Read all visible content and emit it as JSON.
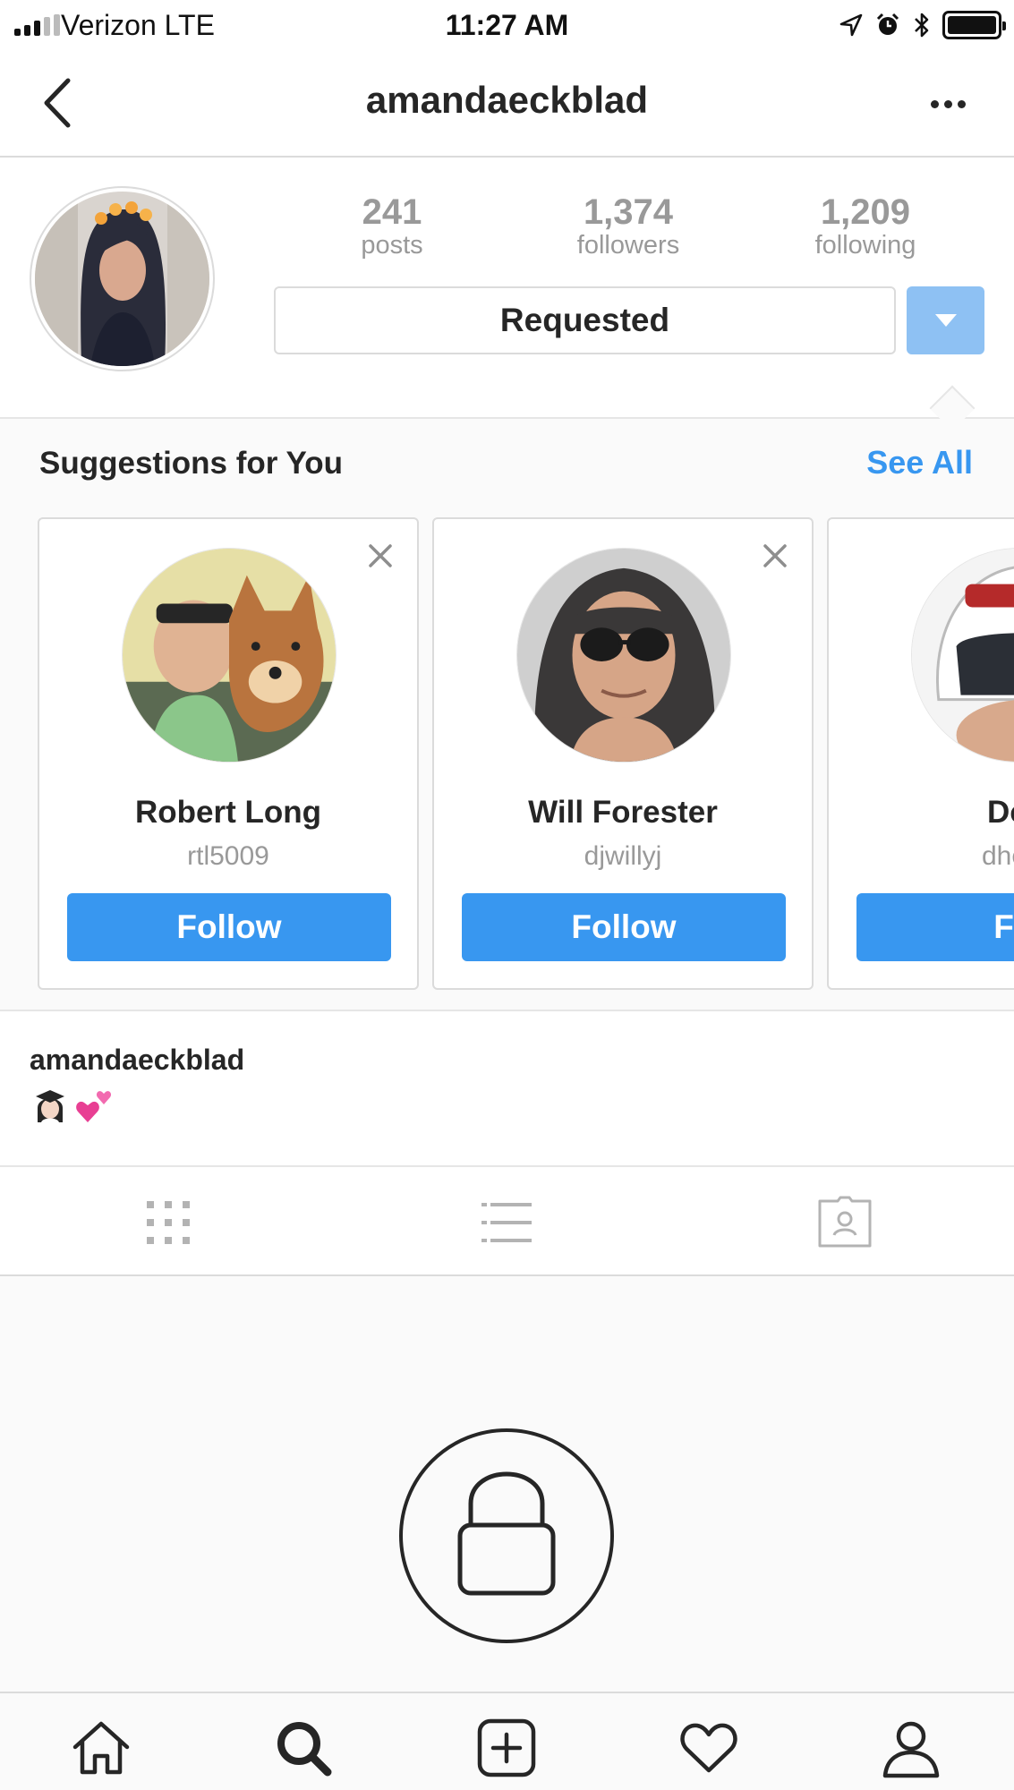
{
  "status_bar": {
    "carrier": "Verizon  LTE",
    "time": "11:27 AM",
    "battery_level": 1.0
  },
  "nav": {
    "title": "amandaeckblad",
    "back_icon": "chevron-left-icon",
    "more_icon": "ellipsis-icon"
  },
  "profile": {
    "stats": [
      {
        "value": "241",
        "label": "posts"
      },
      {
        "value": "1,374",
        "label": "followers"
      },
      {
        "value": "1,209",
        "label": "following"
      }
    ],
    "requested_label": "Requested",
    "dropdown_icon": "caret-down-icon"
  },
  "suggestions": {
    "title": "Suggestions for You",
    "see_all": "See All",
    "cards": [
      {
        "name": "Robert Long",
        "handle": "rtl5009",
        "button": "Follow"
      },
      {
        "name": "Will Forester",
        "handle": "djwillyj",
        "button": "Follow"
      },
      {
        "name": "Dou",
        "handle": "dheck",
        "button": "Fol"
      }
    ]
  },
  "bio": {
    "username": "amandaeckblad",
    "emojis": [
      "graduate-emoji",
      "two-hearts-emoji"
    ]
  },
  "view_tabs": [
    "grid-icon",
    "list-icon",
    "tagged-icon"
  ],
  "private_icon": "lock-icon",
  "tab_bar": [
    "home-icon",
    "search-icon",
    "add-post-icon",
    "heart-icon",
    "profile-icon"
  ],
  "colors": {
    "accent": "#3897f0",
    "accent_light": "#8ec1f3",
    "text": "#262626",
    "muted": "#999999",
    "border": "#dbdbdb"
  }
}
